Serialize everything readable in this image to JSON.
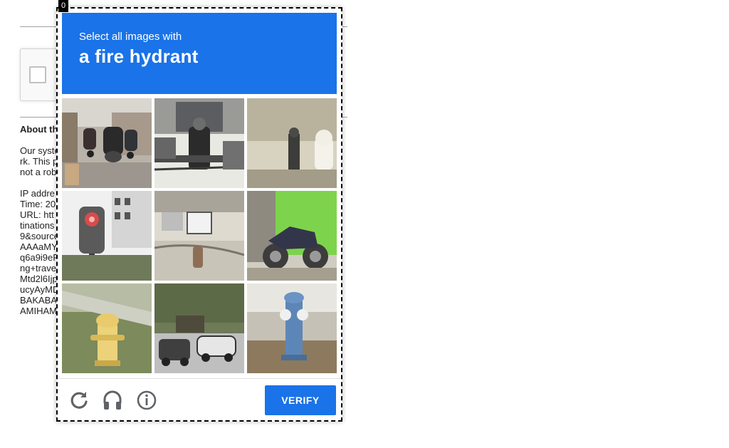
{
  "page": {
    "about_heading": "About th",
    "about_lines": [
      "Our syste",
      "rk. This p",
      "not a rob"
    ],
    "meta_lines": [
      "IP addre",
      "Time: 20",
      "URL: htt",
      "tinations",
      "9&source",
      "AAAaMY",
      "q6a9i9eP",
      "ng+trave",
      "Mtd2l6Ijp",
      "ucyAyMD",
      "BAKABA",
      "AMIHAM"
    ]
  },
  "challenge": {
    "frame_counter": "0",
    "instruction": "Select all images with",
    "target": "a fire hydrant",
    "verify_label": "VERIFY",
    "tiles": [
      {
        "subject": "street-scooters"
      },
      {
        "subject": "motorcyclist"
      },
      {
        "subject": "hydrant-partial"
      },
      {
        "subject": "traffic-light"
      },
      {
        "subject": "street-vehicles"
      },
      {
        "subject": "motorcycle"
      },
      {
        "subject": "yellow-fire-hydrant"
      },
      {
        "subject": "parked-cars"
      },
      {
        "subject": "blue-fire-hydrant"
      }
    ],
    "icons": [
      "reload-icon",
      "audio-headphones-icon",
      "info-icon"
    ]
  },
  "colors": {
    "accent": "#1a73e8"
  }
}
